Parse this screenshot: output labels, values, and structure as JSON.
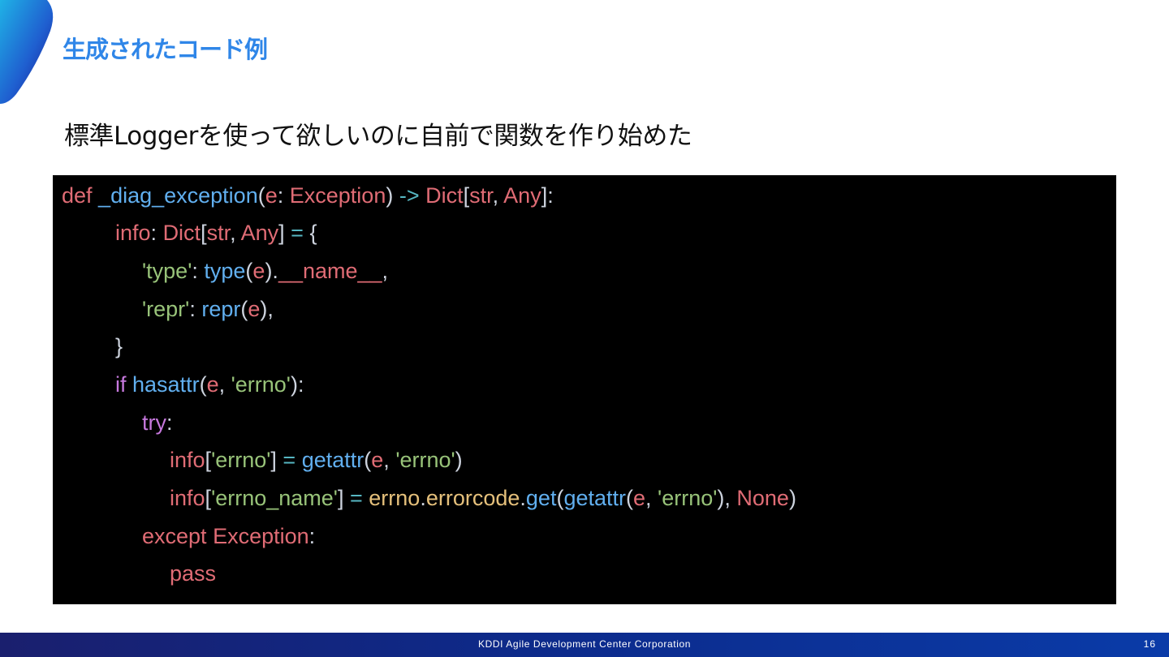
{
  "slide": {
    "title": "生成されたコード例",
    "subtitle": "標準Loggerを使って欲しいのに自前で関数を作り始めた"
  },
  "code": {
    "lines": [
      [
        {
          "t": "def ",
          "c": "kw"
        },
        {
          "t": "_diag_exception",
          "c": "fn"
        },
        {
          "t": "(",
          "c": "pun"
        },
        {
          "t": "e",
          "c": "kw"
        },
        {
          "t": ": ",
          "c": "pun"
        },
        {
          "t": "Exception",
          "c": "kw"
        },
        {
          "t": ") ",
          "c": "pun"
        },
        {
          "t": "->",
          "c": "op"
        },
        {
          "t": " ",
          "c": "pun"
        },
        {
          "t": "Dict",
          "c": "kw"
        },
        {
          "t": "[",
          "c": "pun"
        },
        {
          "t": "str",
          "c": "kw"
        },
        {
          "t": ", ",
          "c": "pun"
        },
        {
          "t": "Any",
          "c": "kw"
        },
        {
          "t": "]:",
          "c": "pun"
        }
      ],
      [
        {
          "t": "info",
          "c": "kw"
        },
        {
          "t": ": ",
          "c": "pun"
        },
        {
          "t": "Dict",
          "c": "kw"
        },
        {
          "t": "[",
          "c": "pun"
        },
        {
          "t": "str",
          "c": "kw"
        },
        {
          "t": ", ",
          "c": "pun"
        },
        {
          "t": "Any",
          "c": "kw"
        },
        {
          "t": "] ",
          "c": "pun"
        },
        {
          "t": "=",
          "c": "op"
        },
        {
          "t": " {",
          "c": "pun"
        }
      ],
      [
        {
          "t": "'type'",
          "c": "str"
        },
        {
          "t": ": ",
          "c": "pun"
        },
        {
          "t": "type",
          "c": "fn"
        },
        {
          "t": "(",
          "c": "pun"
        },
        {
          "t": "e",
          "c": "kw"
        },
        {
          "t": ").",
          "c": "pun"
        },
        {
          "t": "__name__",
          "c": "kw"
        },
        {
          "t": ",",
          "c": "pun"
        }
      ],
      [
        {
          "t": "'repr'",
          "c": "str"
        },
        {
          "t": ": ",
          "c": "pun"
        },
        {
          "t": "repr",
          "c": "fn"
        },
        {
          "t": "(",
          "c": "pun"
        },
        {
          "t": "e",
          "c": "kw"
        },
        {
          "t": "),",
          "c": "pun"
        }
      ],
      [
        {
          "t": "}",
          "c": "pun"
        }
      ],
      [
        {
          "t": "if ",
          "c": "ctl"
        },
        {
          "t": "hasattr",
          "c": "fn"
        },
        {
          "t": "(",
          "c": "pun"
        },
        {
          "t": "e",
          "c": "kw"
        },
        {
          "t": ", ",
          "c": "pun"
        },
        {
          "t": "'errno'",
          "c": "str"
        },
        {
          "t": "):",
          "c": "pun"
        }
      ],
      [
        {
          "t": "try",
          "c": "ctl"
        },
        {
          "t": ":",
          "c": "pun"
        }
      ],
      [
        {
          "t": "info",
          "c": "kw"
        },
        {
          "t": "[",
          "c": "pun"
        },
        {
          "t": "'errno'",
          "c": "str"
        },
        {
          "t": "] ",
          "c": "pun"
        },
        {
          "t": "=",
          "c": "op"
        },
        {
          "t": " ",
          "c": "pun"
        },
        {
          "t": "getattr",
          "c": "fn"
        },
        {
          "t": "(",
          "c": "pun"
        },
        {
          "t": "e",
          "c": "kw"
        },
        {
          "t": ", ",
          "c": "pun"
        },
        {
          "t": "'errno'",
          "c": "str"
        },
        {
          "t": ")",
          "c": "pun"
        }
      ],
      [
        {
          "t": "info",
          "c": "kw"
        },
        {
          "t": "[",
          "c": "pun"
        },
        {
          "t": "'errno_name'",
          "c": "str"
        },
        {
          "t": "] ",
          "c": "pun"
        },
        {
          "t": "=",
          "c": "op"
        },
        {
          "t": " ",
          "c": "pun"
        },
        {
          "t": "errno",
          "c": "cls"
        },
        {
          "t": ".",
          "c": "pun"
        },
        {
          "t": "errorcode",
          "c": "cls"
        },
        {
          "t": ".",
          "c": "pun"
        },
        {
          "t": "get",
          "c": "fn"
        },
        {
          "t": "(",
          "c": "pun"
        },
        {
          "t": "getattr",
          "c": "fn"
        },
        {
          "t": "(",
          "c": "pun"
        },
        {
          "t": "e",
          "c": "kw"
        },
        {
          "t": ", ",
          "c": "pun"
        },
        {
          "t": "'errno'",
          "c": "str"
        },
        {
          "t": "), ",
          "c": "pun"
        },
        {
          "t": "None",
          "c": "kw"
        },
        {
          "t": ")",
          "c": "pun"
        }
      ],
      [
        {
          "t": "except ",
          "c": "kw"
        },
        {
          "t": "Exception",
          "c": "kw"
        },
        {
          "t": ":",
          "c": "pun"
        }
      ],
      [
        {
          "t": "pass",
          "c": "kw"
        }
      ]
    ]
  },
  "footer": {
    "company": "KDDI Agile Development Center Corporation",
    "page_number": "16"
  }
}
